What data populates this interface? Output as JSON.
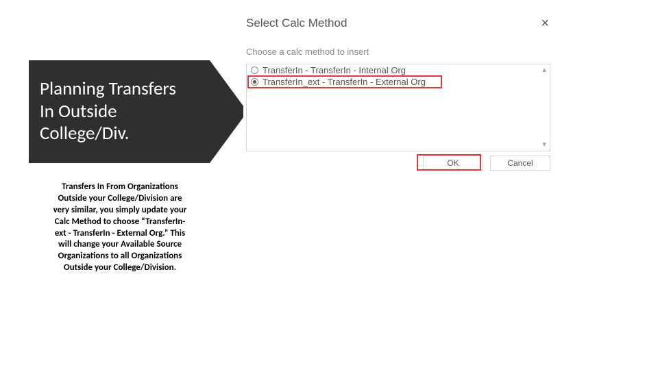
{
  "banner": {
    "title": "Planning Transfers In Outside College/Div."
  },
  "description": "Transfers In From Organizations Outside your College/Division are very similar, you simply update your Calc Method to choose “TransferIn-ext - TransferIn - External Org.” This will change your Available Source Organizations to all Organizations Outside your College/Division.",
  "dialog": {
    "title": "Select Calc Method",
    "subtitle": "Choose a calc method to insert",
    "options": {
      "opt1": "TransferIn - TransferIn - Internal Org",
      "opt2": "TransferIn_ext - TransferIn - External Org"
    },
    "ok_label": "OK",
    "cancel_label": "Cancel"
  }
}
